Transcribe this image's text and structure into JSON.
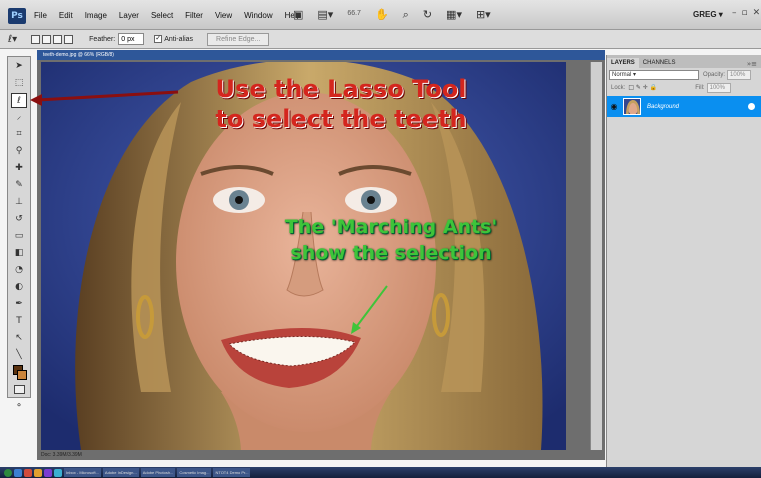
{
  "app": {
    "logo": "Ps",
    "menu": [
      "File",
      "Edit",
      "Image",
      "Layer",
      "Select",
      "Filter",
      "View",
      "Window",
      "Help"
    ],
    "zoom": "66.7",
    "workspace_user": "GREG",
    "window_controls": [
      "–",
      "▫",
      "✕"
    ]
  },
  "options_bar": {
    "feather_label": "Feather:",
    "feather_value": "0 px",
    "anti_alias_label": "Anti-alias",
    "anti_alias_checked": true,
    "refine_edge_label": "Refine Edge..."
  },
  "tools": {
    "active": "lasso",
    "foreground_color": "#5a3210",
    "background_color": "#c9843c"
  },
  "document": {
    "title": "teeth-demo.jpg @ 66% (RGB/8)",
    "status": "Doc: 3.39M/3.39M"
  },
  "annotations": {
    "lasso_line1": "Use the Lasso Tool",
    "lasso_line2": "to select the teeth",
    "ants_line1": "The 'Marching Ants'",
    "ants_line2": "show the selection",
    "lasso_color": "#d4261e",
    "ants_color": "#3ec43a"
  },
  "layers_panel": {
    "tabs": [
      "LAYERS",
      "CHANNELS"
    ],
    "blend_mode": "Normal",
    "opacity_label": "Opacity:",
    "opacity_value": "100%",
    "lock_label": "Lock:",
    "fill_label": "Fill:",
    "fill_value": "100%",
    "layer_name": "Background"
  },
  "taskbar": {
    "buttons": [
      "Inbox - Microsoft...",
      "Adobe InDesign...",
      "Adobe Photosh...",
      "Cosmetic Imag...",
      "NTOT4 Demo Pr..."
    ]
  }
}
